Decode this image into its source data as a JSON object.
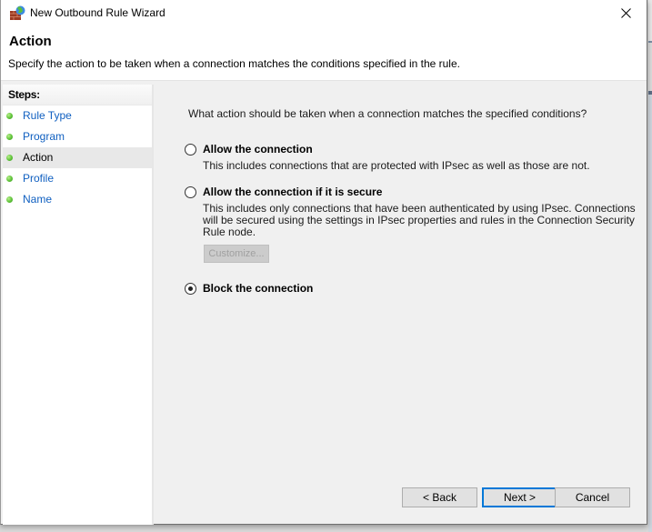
{
  "window": {
    "title": "New Outbound Rule Wizard",
    "app_icon": "firewall-globe-icon",
    "close_icon": "close-icon"
  },
  "header": {
    "title": "Action",
    "description": "Specify the action to be taken when a connection matches the conditions specified in the rule."
  },
  "steps": {
    "title": "Steps:",
    "items": [
      {
        "label": "Rule Type",
        "current": false
      },
      {
        "label": "Program",
        "current": false
      },
      {
        "label": "Action",
        "current": true
      },
      {
        "label": "Profile",
        "current": false
      },
      {
        "label": "Name",
        "current": false
      }
    ]
  },
  "main": {
    "question": "What action should be taken when a connection matches the specified conditions?",
    "options": [
      {
        "label": "Allow the connection",
        "description_lines": [
          "This includes connections that are protected with IPsec as well as those are not."
        ],
        "selected": false
      },
      {
        "label": "Allow the connection if it is secure",
        "description_lines": [
          "This includes only connections that have been authenticated by using IPsec.  Connections",
          "will be secured using the settings in IPsec properties and rules in the Connection Security",
          "Rule node."
        ],
        "selected": false
      },
      {
        "label": "Block the connection",
        "description_lines": [],
        "selected": true
      }
    ],
    "customize_label": "Customize..."
  },
  "footer": {
    "back_label": "< Back",
    "next_label": "Next >",
    "cancel_label": "Cancel"
  },
  "colors": {
    "step_link": "#0f5fc0",
    "default_button_border": "#0078d7",
    "panel_background": "#f0f0f0"
  }
}
